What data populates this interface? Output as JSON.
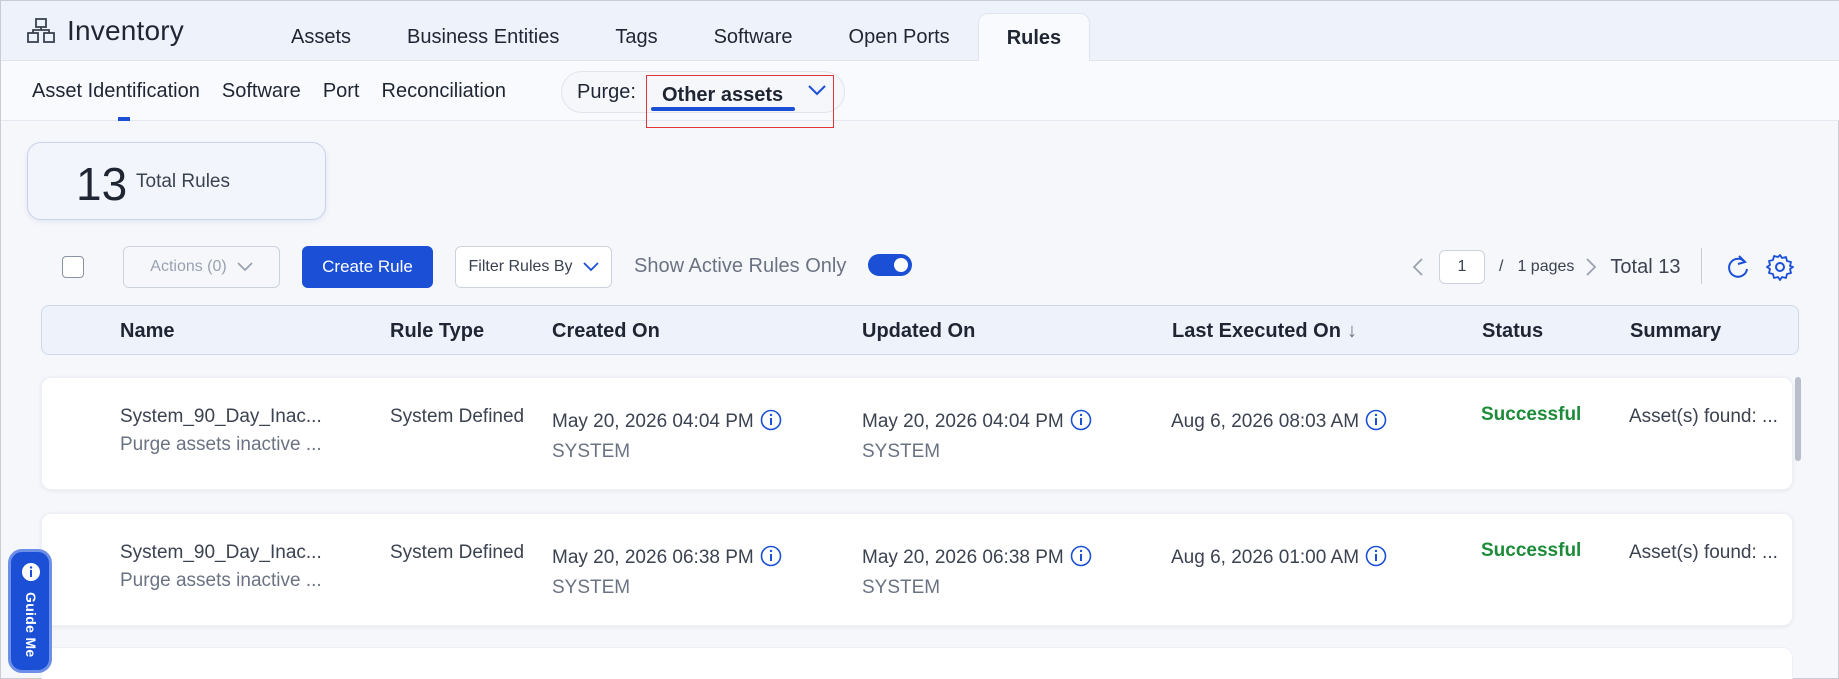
{
  "app": {
    "title": "Inventory"
  },
  "main_tabs": [
    {
      "label": "Assets"
    },
    {
      "label": "Business Entities"
    },
    {
      "label": "Tags"
    },
    {
      "label": "Software"
    },
    {
      "label": "Open Ports"
    },
    {
      "label": "Rules",
      "active": true
    }
  ],
  "sub_tabs": [
    {
      "label": "Asset Identification",
      "active": true
    },
    {
      "label": "Software"
    },
    {
      "label": "Port"
    },
    {
      "label": "Reconciliation"
    }
  ],
  "purge": {
    "label": "Purge:",
    "selected": "Other assets"
  },
  "summary": {
    "total": "13",
    "label": "Total Rules"
  },
  "toolbar": {
    "actions_label": "Actions (0)",
    "create_label": "Create Rule",
    "filter_label": "Filter Rules By",
    "active_only_label": "Show Active Rules Only",
    "active_only_on": true
  },
  "pager": {
    "current": "1",
    "separator": "/",
    "pages_label": "1 pages",
    "total_label": "Total 13"
  },
  "table": {
    "headers": {
      "name": "Name",
      "rule_type": "Rule Type",
      "created_on": "Created On",
      "updated_on": "Updated On",
      "last_executed": "Last Executed On",
      "status": "Status",
      "summary": "Summary"
    },
    "rows": [
      {
        "name": "System_90_Day_Inac...",
        "description": "Purge assets inactive ...",
        "rule_type": "System Defined",
        "created_on": "May 20, 2026 04:04 PM",
        "created_by": "SYSTEM",
        "updated_on": "May 20, 2026 04:04 PM",
        "updated_by": "SYSTEM",
        "last_executed": "Aug 6, 2026 08:03 AM",
        "status": "Successful",
        "summary": "Asset(s) found: ..."
      },
      {
        "name": "System_90_Day_Inac...",
        "description": "Purge assets inactive ...",
        "rule_type": "System Defined",
        "created_on": "May 20, 2026 06:38 PM",
        "created_by": "SYSTEM",
        "updated_on": "May 20, 2026 06:38 PM",
        "updated_by": "SYSTEM",
        "last_executed": "Aug 6, 2026 01:00 AM",
        "status": "Successful",
        "summary": "Asset(s) found: ..."
      }
    ]
  },
  "guide": {
    "label": "Guide Me"
  },
  "colors": {
    "accent": "#1a4fd6",
    "success": "#1e8b3a",
    "highlight_border": "#e0353b"
  }
}
